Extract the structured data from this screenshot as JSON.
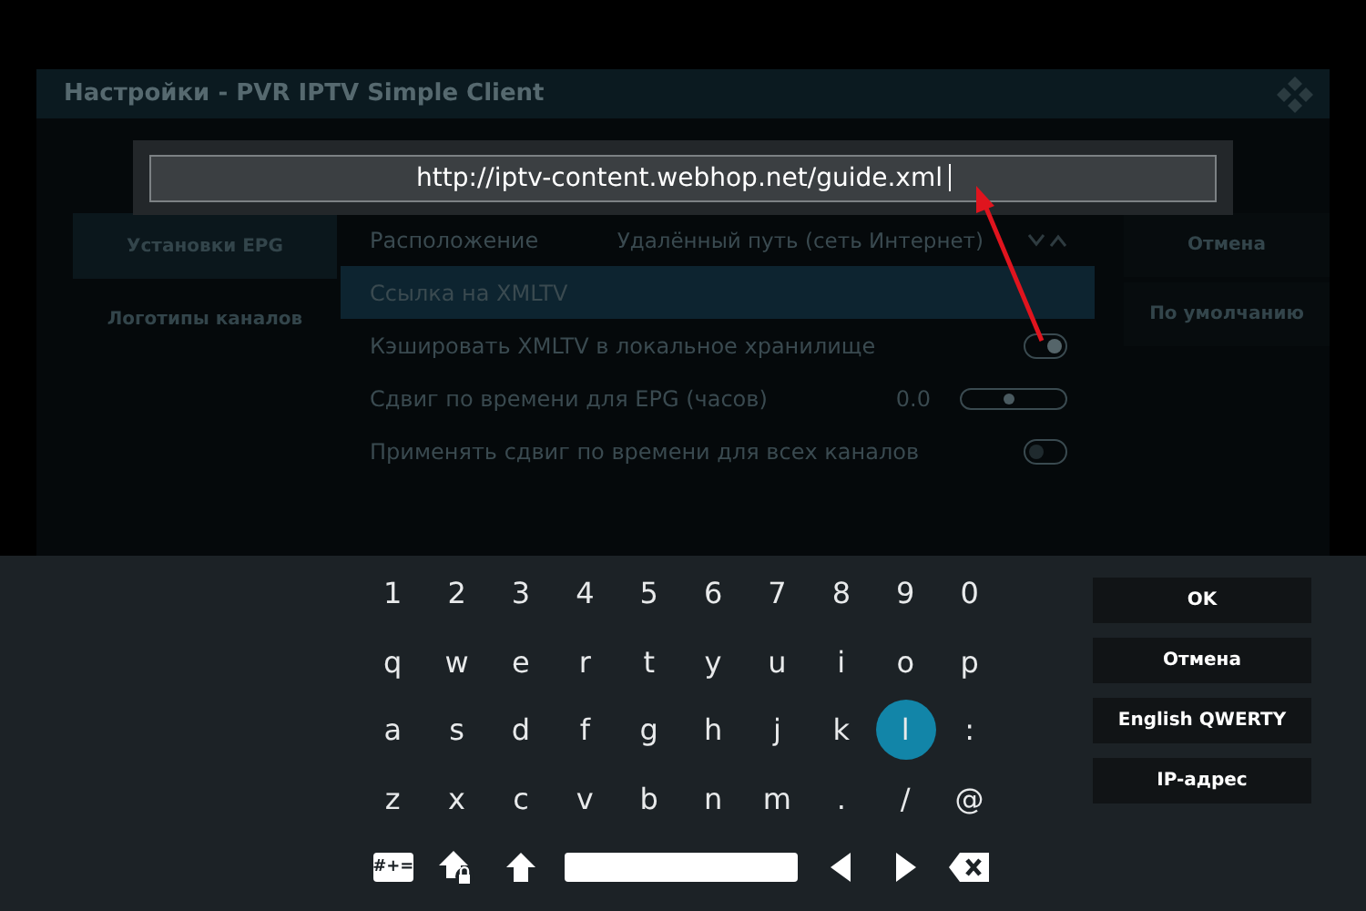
{
  "window": {
    "title": "Настройки - PVR IPTV Simple Client"
  },
  "sidebar": {
    "items": [
      {
        "label": "Установки EPG",
        "selected": true
      },
      {
        "label": "Логотипы каналов",
        "selected": false
      }
    ]
  },
  "settings": [
    {
      "kind": "select",
      "label": "Расположение",
      "value": "Удалённый путь (сеть Интернет)",
      "selected": false
    },
    {
      "kind": "text",
      "label": "Ссылка на XMLTV",
      "selected": true
    },
    {
      "kind": "toggle",
      "label": "Кэшировать XMLTV в локальное хранилище",
      "on": true,
      "selected": false
    },
    {
      "kind": "slider",
      "label": "Сдвиг по времени для EPG (часов)",
      "value": "0.0",
      "level": 0.45,
      "selected": false
    },
    {
      "kind": "toggle",
      "label": "Применять сдвиг по времени для всех каналов",
      "on": false,
      "selected": false
    }
  ],
  "dialog_buttons": [
    "Отмена",
    "По умолчанию"
  ],
  "input": {
    "value": "http://iptv-content.webhop.net/guide.xml"
  },
  "keyboard": {
    "rows": [
      [
        {
          "label": "1",
          "selected": false
        },
        {
          "label": "2",
          "selected": false
        },
        {
          "label": "3",
          "selected": false
        },
        {
          "label": "4",
          "selected": false
        },
        {
          "label": "5",
          "selected": false
        },
        {
          "label": "6",
          "selected": false
        },
        {
          "label": "7",
          "selected": false
        },
        {
          "label": "8",
          "selected": false
        },
        {
          "label": "9",
          "selected": false
        },
        {
          "label": "0",
          "selected": false
        }
      ],
      [
        {
          "label": "q",
          "selected": false
        },
        {
          "label": "w",
          "selected": false
        },
        {
          "label": "e",
          "selected": false
        },
        {
          "label": "r",
          "selected": false
        },
        {
          "label": "t",
          "selected": false
        },
        {
          "label": "y",
          "selected": false
        },
        {
          "label": "u",
          "selected": false
        },
        {
          "label": "i",
          "selected": false
        },
        {
          "label": "o",
          "selected": false
        },
        {
          "label": "p",
          "selected": false
        }
      ],
      [
        {
          "label": "a",
          "selected": false
        },
        {
          "label": "s",
          "selected": false
        },
        {
          "label": "d",
          "selected": false
        },
        {
          "label": "f",
          "selected": false
        },
        {
          "label": "g",
          "selected": false
        },
        {
          "label": "h",
          "selected": false
        },
        {
          "label": "j",
          "selected": false
        },
        {
          "label": "k",
          "selected": false
        },
        {
          "label": "l",
          "selected": true
        },
        {
          "label": ":",
          "selected": false
        }
      ],
      [
        {
          "label": "z",
          "selected": false
        },
        {
          "label": "x",
          "selected": false
        },
        {
          "label": "c",
          "selected": false
        },
        {
          "label": "v",
          "selected": false
        },
        {
          "label": "b",
          "selected": false
        },
        {
          "label": "n",
          "selected": false
        },
        {
          "label": "m",
          "selected": false
        },
        {
          "label": ".",
          "selected": false
        },
        {
          "label": "/",
          "selected": false
        },
        {
          "label": "@",
          "selected": false
        }
      ]
    ],
    "controls": [
      {
        "kind": "symbols",
        "label": "#+="
      },
      {
        "kind": "capslock"
      },
      {
        "kind": "shift"
      },
      {
        "kind": "space"
      },
      {
        "kind": "left"
      },
      {
        "kind": "right"
      },
      {
        "kind": "backspace"
      }
    ],
    "buttons": [
      "OK",
      "Отмена",
      "English QWERTY",
      "IP-адрес"
    ]
  }
}
